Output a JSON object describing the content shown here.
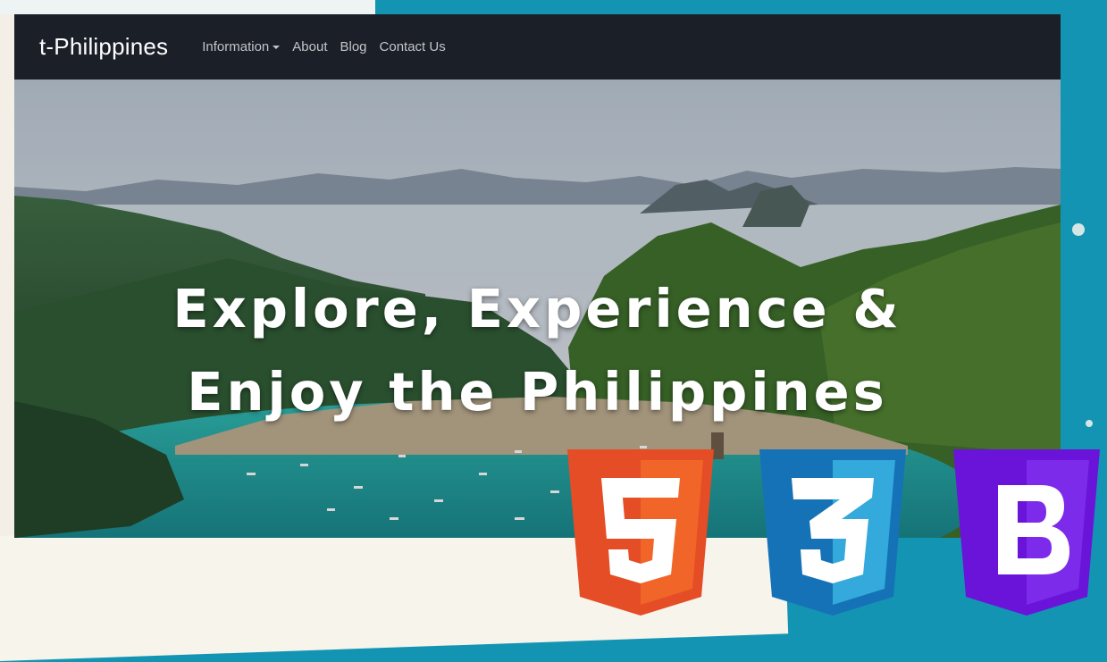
{
  "navbar": {
    "brand": "t-Philippines",
    "items": [
      {
        "label": "Information",
        "dropdown": true
      },
      {
        "label": "About"
      },
      {
        "label": "Blog"
      },
      {
        "label": "Contact Us"
      }
    ]
  },
  "hero": {
    "line1": "Explore, Experience &",
    "line2": "Enjoy the Philippines",
    "image": "aerial-bay-with-mountains-and-boats"
  },
  "logos": [
    {
      "name": "html5-logo",
      "glyph": "5",
      "color": "#e44d26",
      "light": "#f16529"
    },
    {
      "name": "css3-logo",
      "glyph": "3",
      "color": "#1572b6",
      "light": "#33a9dc"
    },
    {
      "name": "bootstrap-logo",
      "glyph": "B",
      "color": "#6a14d9",
      "light": "#7c2bea"
    }
  ],
  "colors": {
    "navbar_bg": "#1b1f27",
    "page_bg": "#1494b3",
    "sea": "#1a8a8c"
  }
}
